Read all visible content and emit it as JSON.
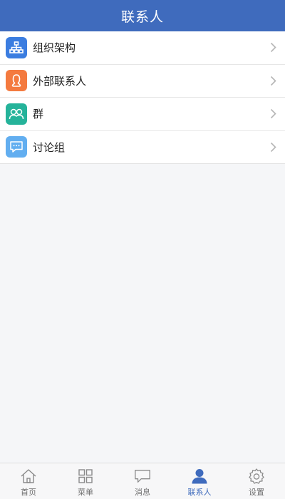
{
  "header": {
    "title": "联系人"
  },
  "colors": {
    "brand": "#3f6bbd",
    "org_icon": "#3b7de0",
    "external_icon": "#f47a3f",
    "group_icon": "#25b39a",
    "discussion_icon": "#62aef0"
  },
  "list": {
    "items": [
      {
        "label": "组织架构",
        "icon": "org-chart-icon"
      },
      {
        "label": "外部联系人",
        "icon": "external-contact-icon"
      },
      {
        "label": "群",
        "icon": "group-icon"
      },
      {
        "label": "讨论组",
        "icon": "discussion-icon"
      }
    ]
  },
  "tabbar": {
    "tabs": [
      {
        "label": "首页",
        "icon": "home-icon",
        "active": false
      },
      {
        "label": "菜单",
        "icon": "grid-icon",
        "active": false
      },
      {
        "label": "消息",
        "icon": "message-icon",
        "active": false
      },
      {
        "label": "联系人",
        "icon": "person-icon",
        "active": true
      },
      {
        "label": "设置",
        "icon": "gear-icon",
        "active": false
      }
    ]
  }
}
